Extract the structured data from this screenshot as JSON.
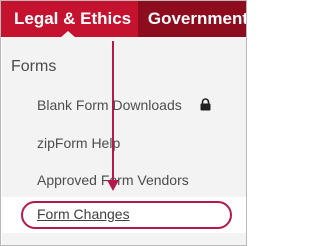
{
  "nav": {
    "tabs": [
      {
        "label": "Legal & Ethics",
        "active": true
      },
      {
        "label": "Government",
        "active": false
      }
    ]
  },
  "menu": {
    "section_title": "Forms",
    "items": [
      {
        "label": "Blank Form Downloads",
        "icon": "lock-icon"
      },
      {
        "label": "zipForm Help"
      },
      {
        "label": "Approved Form Vendors"
      },
      {
        "label": "Form Changes",
        "highlighted": true
      }
    ]
  },
  "colors": {
    "nav_active": "#c4122f",
    "nav_inactive": "#8d0c1e",
    "annotation": "#b5184d",
    "panel_bg": "#f3f3f3",
    "text": "#4d4d4d"
  }
}
